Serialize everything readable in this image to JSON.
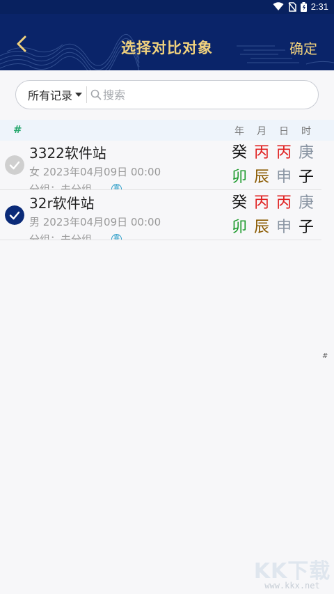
{
  "status_bar": {
    "time": "2:31"
  },
  "app_bar": {
    "title": "选择对比对象",
    "confirm_label": "确定"
  },
  "search": {
    "filter_label": "所有记录",
    "placeholder": "搜索"
  },
  "list_header": {
    "index_symbol": "#",
    "columns": [
      "年",
      "月",
      "日",
      "时"
    ]
  },
  "records": [
    {
      "name": "3322软件站",
      "info": "女 2023年04月09日 00:00",
      "group": "分组：未分组",
      "group_badge": "喜",
      "checked": false,
      "stems": [
        "癸",
        "丙",
        "丙",
        "庚"
      ],
      "branches": [
        "卯",
        "辰",
        "申",
        "子"
      ]
    },
    {
      "name": "32r软件站",
      "info": "男 2023年04月09日 00:00",
      "group": "分组：未分组",
      "group_badge": "喜",
      "checked": true,
      "stems": [
        "癸",
        "丙",
        "丙",
        "庚"
      ],
      "branches": [
        "卯",
        "辰",
        "申",
        "子"
      ]
    }
  ],
  "side_index": "#",
  "watermark": {
    "text": "KK下载",
    "url": "www.kkx.net"
  },
  "element_colors": {
    "癸": "#111111",
    "丙": "#e02020",
    "庚": "#8a95a3",
    "卯": "#1c9a2c",
    "辰": "#8a5a00",
    "申": "#8a95a3",
    "子": "#111111"
  },
  "theme": {
    "header_bg": "#0a2469",
    "header_text": "#f1d27d",
    "checked": "#0a2a78",
    "unchecked": "#cfcfcf",
    "index_green": "#27a86e"
  }
}
